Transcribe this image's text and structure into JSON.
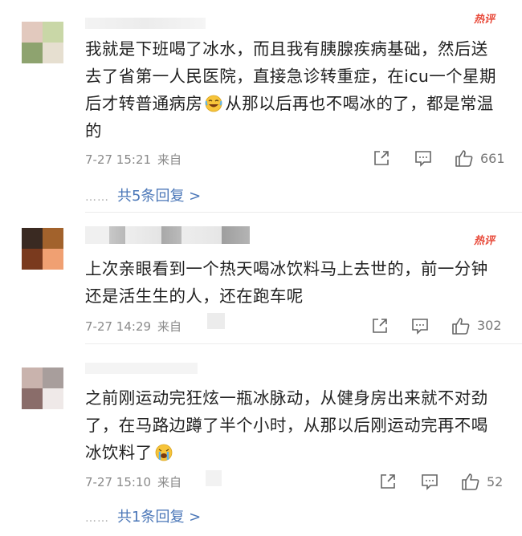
{
  "hot_badge": "热评",
  "comments": [
    {
      "text_before": "我就是下班喝了冰水，而且我有胰腺疾病基础，然后送去了省第一人民医院，直接急诊转重症，在icu一个星期后才转普通病房",
      "emoji": "laugh-cry",
      "text_after": "从那以后再也不喝冰的了，都是常温的",
      "time": "7-27 15:21",
      "source": "来自",
      "likes": "661",
      "replies": "共5条回复 >"
    },
    {
      "text": "上次亲眼看到一个热天喝冰饮料马上去世的，前一分钟还是活生生的人，还在跑车呢",
      "time": "7-27 14:29",
      "source": "来自",
      "likes": "302"
    },
    {
      "text_before": "之前刚运动完狂炫一瓶冰脉动，从健身房出来就不对劲了，在马路边蹲了半个小时，从那以后刚运动完再不喝冰饮料了",
      "emoji": "loud-cry",
      "time": "7-27 15:10",
      "source": "来自",
      "likes": "52",
      "replies": "共1条回复 >"
    }
  ],
  "reply_dots": "……",
  "colors": {
    "accent_link": "#4b77b8",
    "hot_badge": "#e84a3a",
    "meta_gray": "#8a8a8a"
  },
  "icons": [
    "forward-icon",
    "comment-icon",
    "thumbs-up-icon"
  ]
}
